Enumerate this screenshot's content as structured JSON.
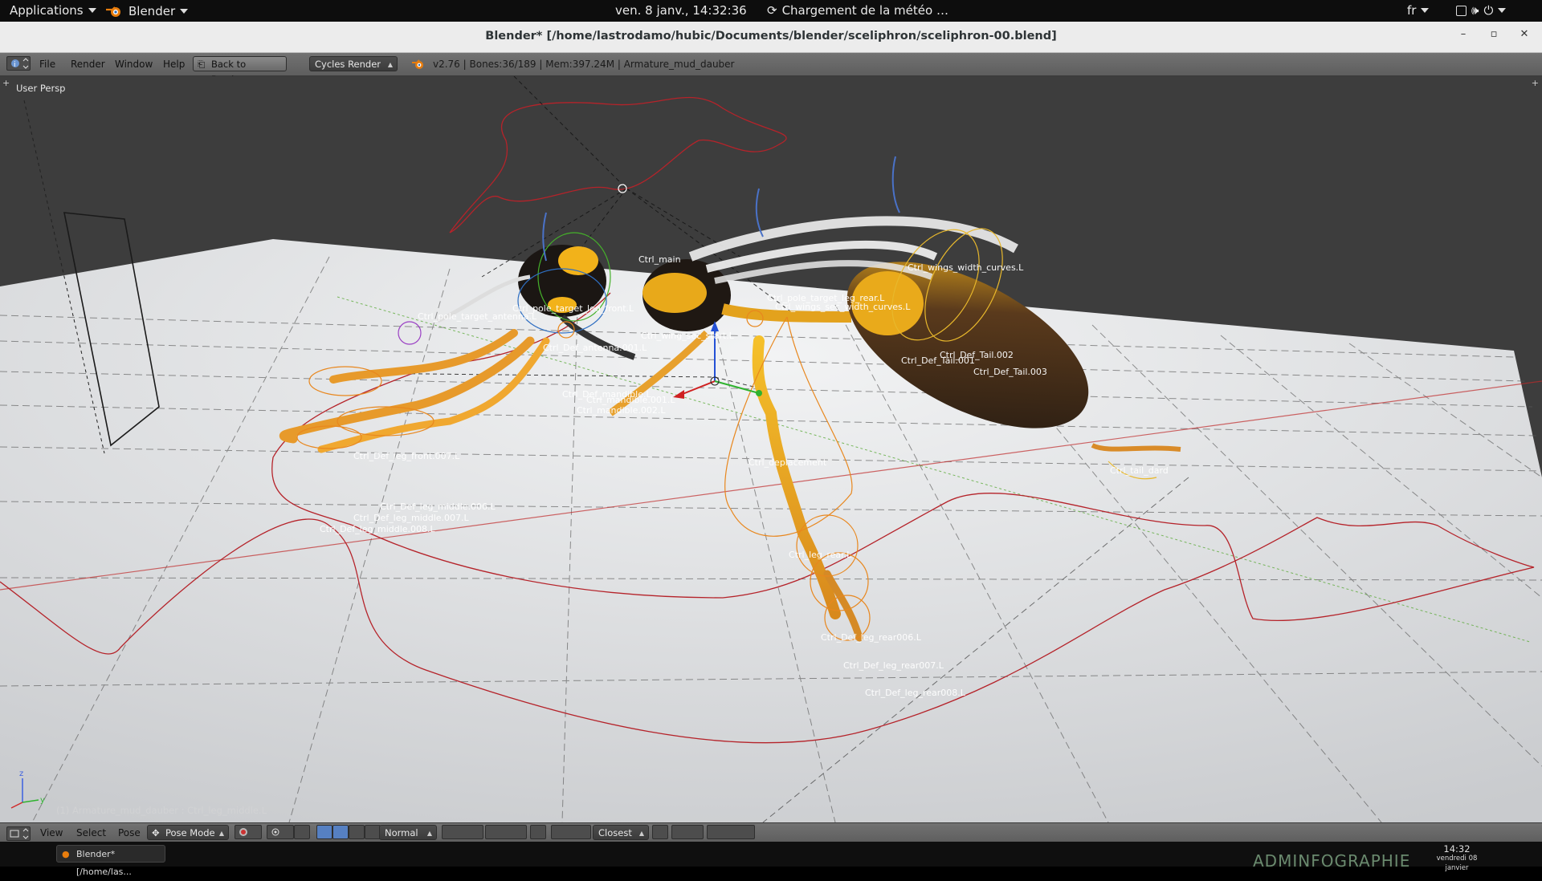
{
  "topbar": {
    "applications": "Applications",
    "app": "Blender",
    "datetime": "ven.  8 janv., 14:32:36",
    "weather": "Chargement de la météo …",
    "lang": "fr"
  },
  "window": {
    "title": "Blender* [/home/lastrodamo/hubic/Documents/blender/sceliphron/sceliphron-00.blend]"
  },
  "header": {
    "menus": [
      "File",
      "Render",
      "Window",
      "Help"
    ],
    "back_button": "Back to Previous",
    "render_engine": "Cycles Render",
    "info": "v2.76 | Bones:36/189 | Mem:397.24M | Armature_mud_dauber"
  },
  "viewport": {
    "view_label": "User Persp",
    "status": "(1) Armature_mud_dauber : Ctrl_leg_middle.L",
    "bone_labels": [
      "Ctrl_main",
      "Ctrl_wings_width_curves.L",
      "Ctrl_pole_target_leg_rear.L",
      "Ctrl_wings_sec_width_curves.L",
      "Ctrl_pole_target_antenna.L",
      "Ctrl_pole_target_leg_front.L",
      "Ctrl_wing_sec_start.L",
      "Ctrl_Def_antenna.001.L",
      "Ctrl_Def_Tail.002",
      "Ctrl_Def_Tail.001",
      "Ctrl_Def_Tail.003",
      "Ctrl_Def_mandible.L",
      "Ctrl_mandible.001.L",
      "Ctrl_mandible.002.L",
      "Ctrl_deplacement",
      "Ctrl_leg_rear.L",
      "Ctrl_Def_leg_rear006.L",
      "Ctrl_Def_leg_rear007.L",
      "Ctrl_Def_leg_rear008.L",
      "Ctrl_tail_dard",
      "Ctrl_Def_leg_middle.006.L",
      "Ctrl_Def_leg_middle.007.L",
      "Ctrl_Def_leg_middle.008.L",
      "Ctrl_Def_leg_front.007.L"
    ]
  },
  "footer": {
    "menus": [
      "View",
      "Select",
      "Pose"
    ],
    "mode": "Pose Mode",
    "pivot": "Normal",
    "snap": "Closest"
  },
  "taskbar": {
    "task": "Blender* [/home/las...",
    "time": "14:32",
    "date": "vendredi 08 janvier",
    "watermark": "ADMINFOGRAPHIE"
  },
  "colors": {
    "viewport_bg": "#3d3d3d",
    "floor": "#d4d6d8",
    "bone_orange": "#e8871e",
    "curve_red": "#b5232a",
    "wasp_yellow": "#f0b21a"
  }
}
